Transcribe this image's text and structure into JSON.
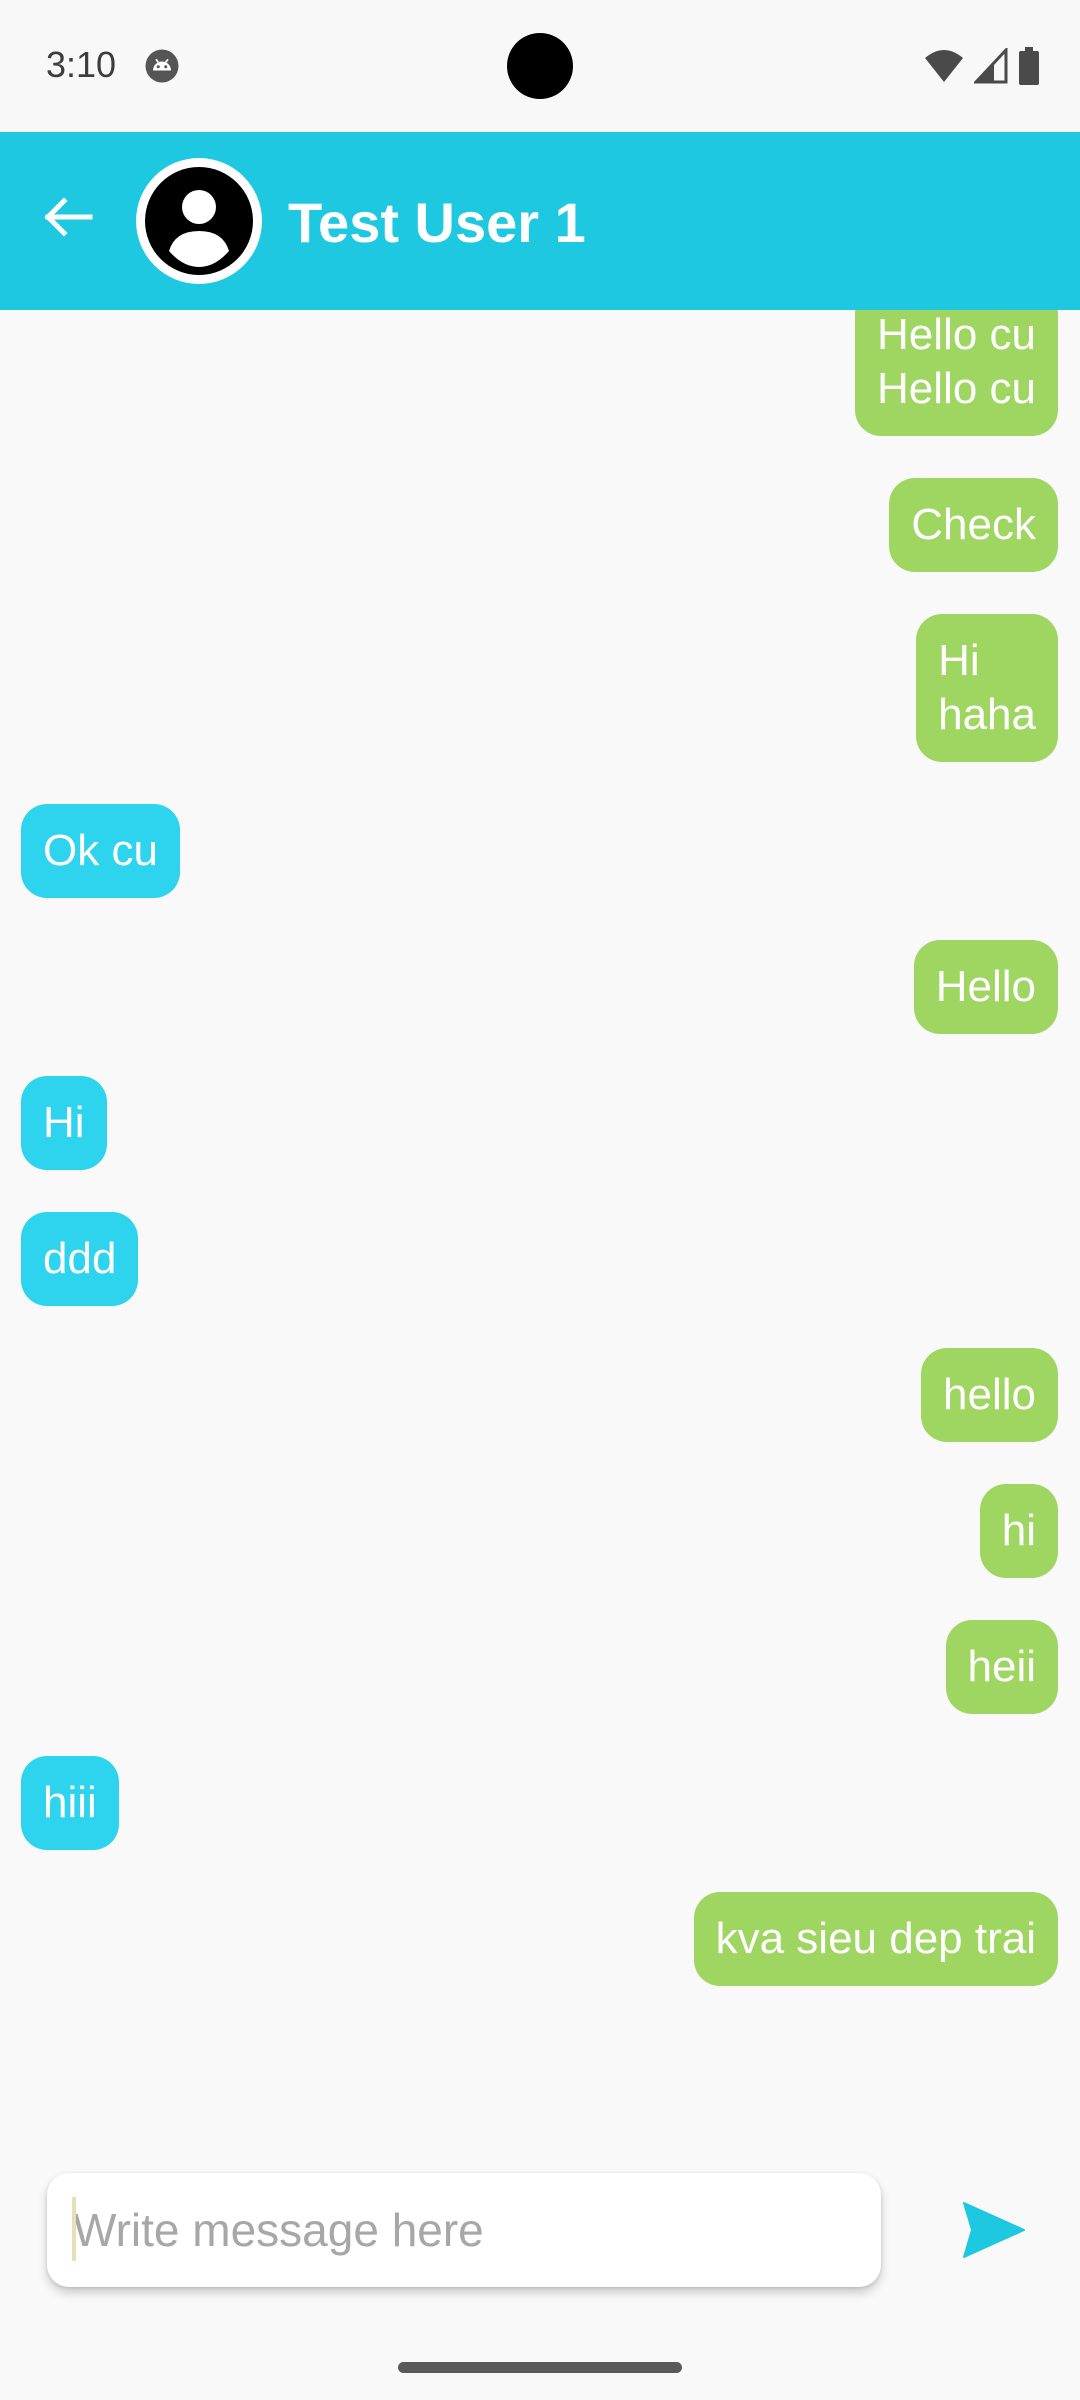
{
  "status_bar": {
    "time": "3:10"
  },
  "icons": {
    "app_notification": "android-robot-icon",
    "wifi": "wifi-icon",
    "signal": "cell-signal-icon",
    "battery": "battery-icon",
    "back": "arrow-left-icon",
    "avatar": "account-circle-icon",
    "send": "send-icon"
  },
  "header": {
    "title": "Test User 1"
  },
  "messages": [
    {
      "direction": "outgoing",
      "text": "Hello cu\nHello cu"
    },
    {
      "direction": "outgoing",
      "text": "Check"
    },
    {
      "direction": "outgoing",
      "text": "Hi\nhaha"
    },
    {
      "direction": "incoming",
      "text": "Ok cu"
    },
    {
      "direction": "outgoing",
      "text": "Hello"
    },
    {
      "direction": "incoming",
      "text": "Hi"
    },
    {
      "direction": "incoming",
      "text": "ddd"
    },
    {
      "direction": "outgoing",
      "text": "hello"
    },
    {
      "direction": "outgoing",
      "text": "hi"
    },
    {
      "direction": "outgoing",
      "text": "heii"
    },
    {
      "direction": "incoming",
      "text": "hiii"
    },
    {
      "direction": "outgoing",
      "text": "kva sieu dep trai"
    }
  ],
  "composer": {
    "value": "",
    "placeholder": "Write message here"
  },
  "colors": {
    "app_bar": "#1dc8e0",
    "outgoing_bubble": "#9fd662",
    "incoming_bubble": "#2ed3ee",
    "send_icon": "#1dc8e0",
    "background": "#f9f9f9"
  }
}
